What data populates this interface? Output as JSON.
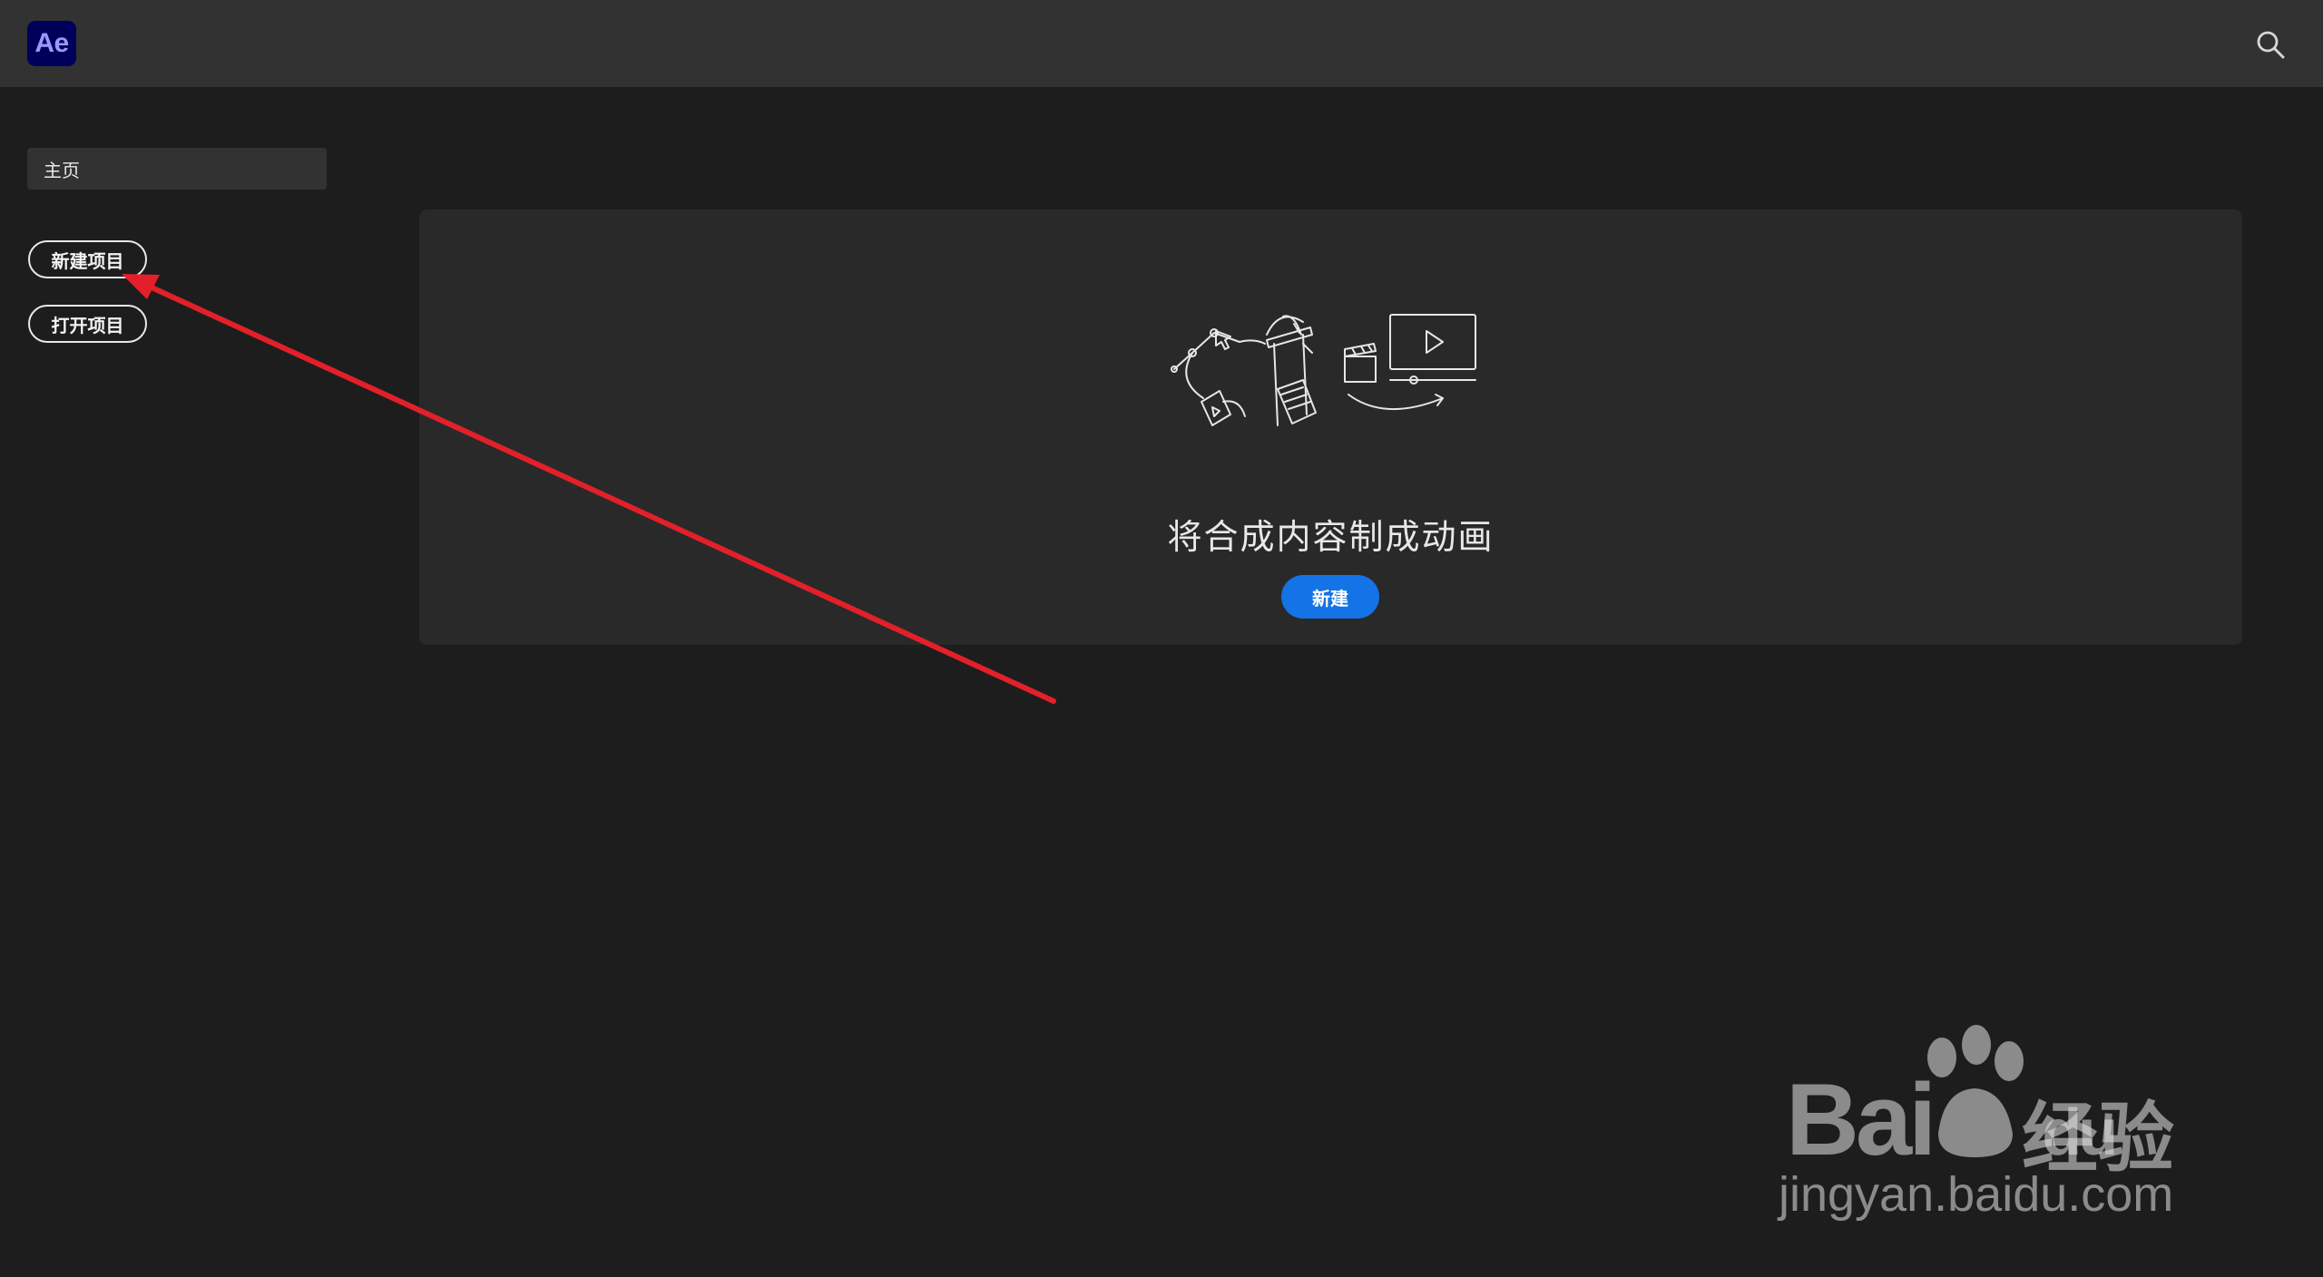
{
  "app": {
    "logo_text": "Ae",
    "brand_color": "#00005b",
    "accent_color": "#1473e6"
  },
  "header": {
    "search_icon": "search-icon"
  },
  "sidebar": {
    "home_label": "主页",
    "new_project_label": "新建项目",
    "open_project_label": "打开项目"
  },
  "main": {
    "illustration_icon": "animation-illustration-icon",
    "heading": "将合成内容制成动画",
    "new_button_label": "新建"
  },
  "annotation": {
    "arrow_color": "#e3202a"
  },
  "watermark": {
    "brand": "Bai",
    "brand_suffix": "du",
    "cn": "经验",
    "url": "jingyan.baidu.com"
  }
}
